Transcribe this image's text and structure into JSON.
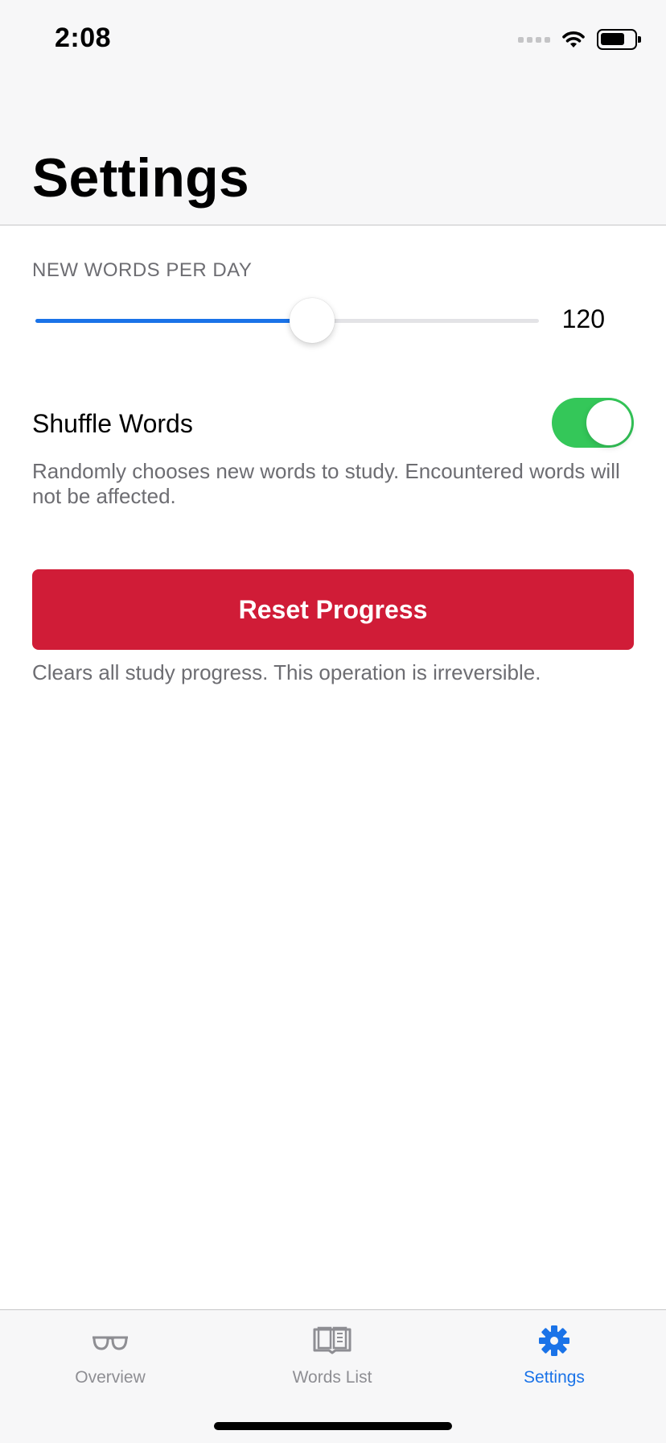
{
  "status_bar": {
    "time": "2:08"
  },
  "header": {
    "title": "Settings"
  },
  "new_words": {
    "section_label": "NEW WORDS PER DAY",
    "slider_fraction": 0.55,
    "value": "120"
  },
  "shuffle": {
    "label": "Shuffle Words",
    "enabled": true,
    "description": "Randomly chooses new words to study. Encountered words will not be affected."
  },
  "reset": {
    "button_label": "Reset Progress",
    "description": "Clears all study progress. This operation is irreversible."
  },
  "tab_bar": {
    "tabs": [
      {
        "label": "Overview",
        "icon": "glasses-icon",
        "active": false
      },
      {
        "label": "Words List",
        "icon": "book-icon",
        "active": false
      },
      {
        "label": "Settings",
        "icon": "gear-icon",
        "active": true
      }
    ]
  },
  "colors": {
    "accent": "#1a73e8",
    "toggle_on": "#34c759",
    "destructive": "#d01c37",
    "secondary_text": "#6d6d72"
  }
}
